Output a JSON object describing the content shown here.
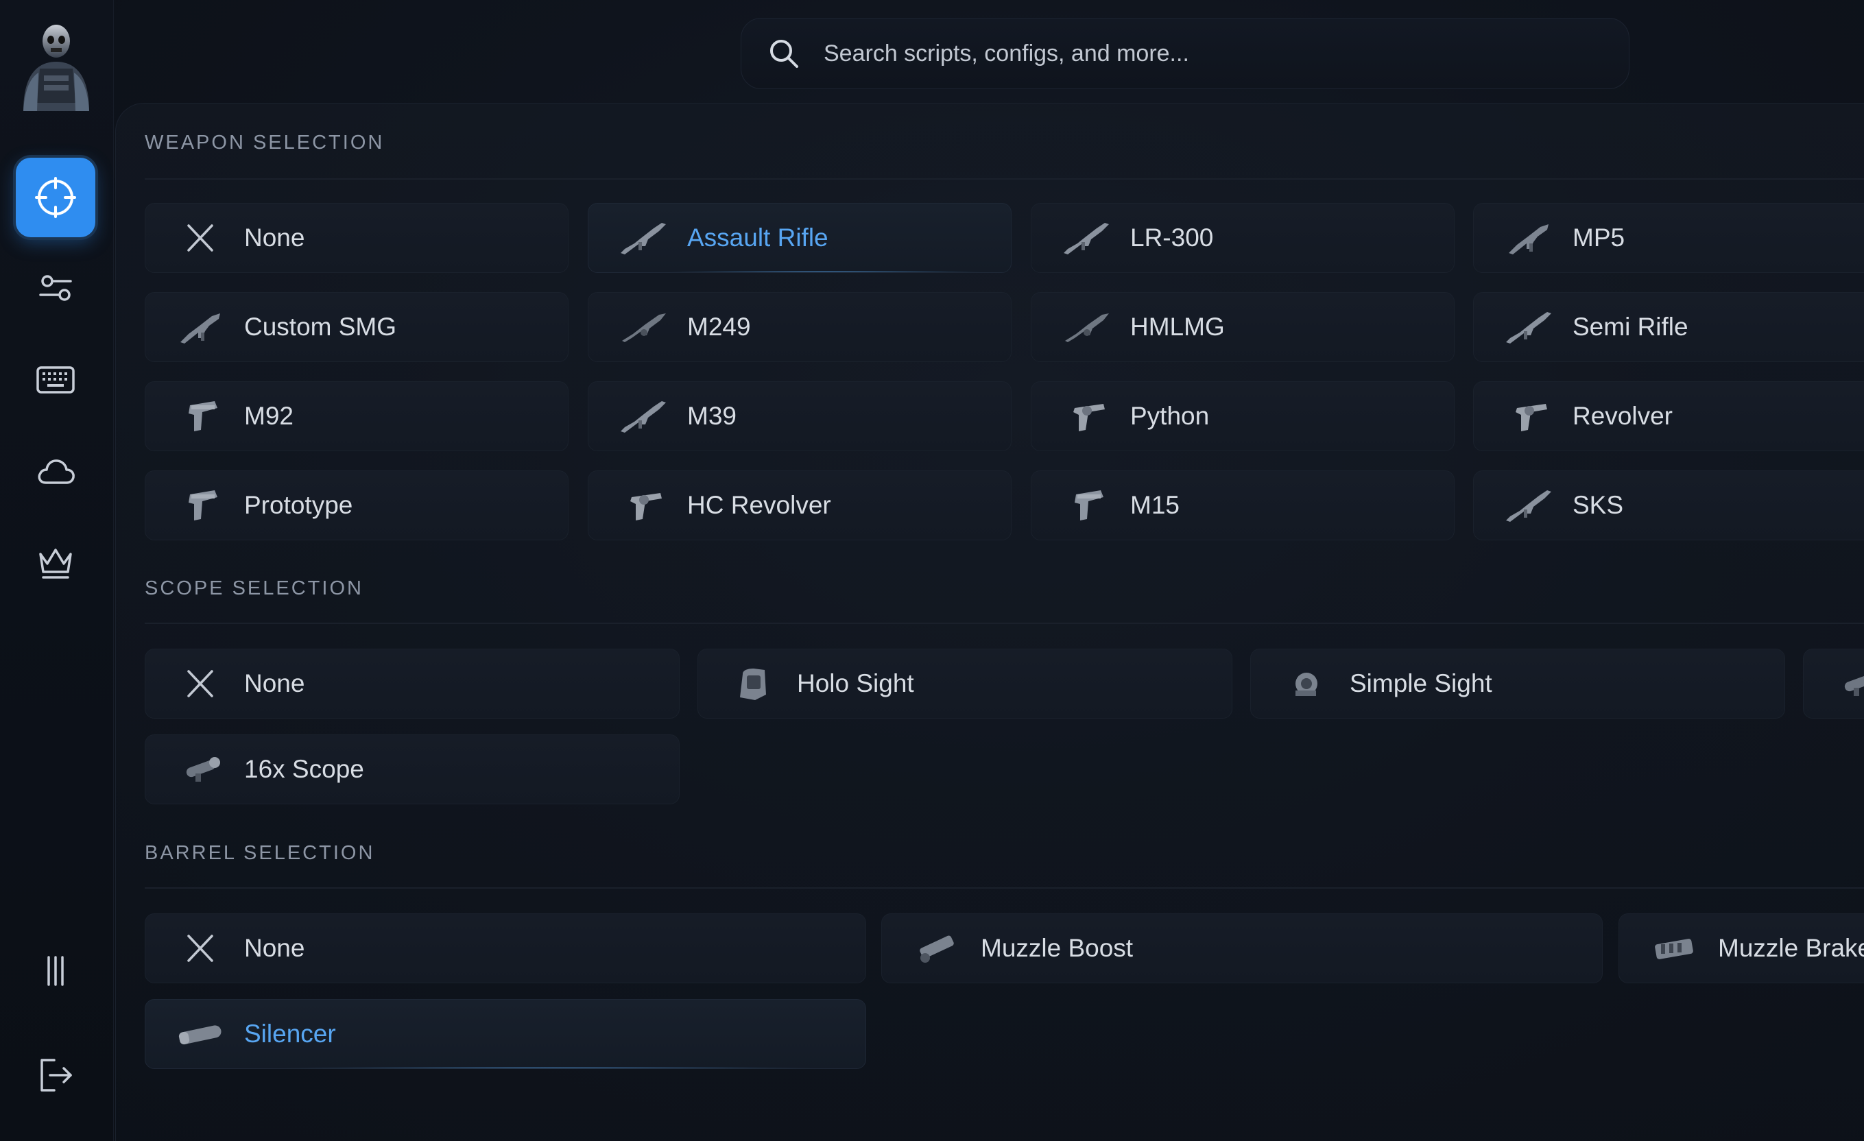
{
  "search": {
    "placeholder": "Search scripts, configs, and more..."
  },
  "sidebar": {
    "items": [
      {
        "name": "crosshair-icon",
        "active": true
      },
      {
        "name": "sliders-icon",
        "active": false
      },
      {
        "name": "keyboard-icon",
        "active": false
      },
      {
        "name": "cloud-icon",
        "active": false
      },
      {
        "name": "crown-icon",
        "active": false
      },
      {
        "name": "menu-bars-icon",
        "active": false
      },
      {
        "name": "logout-icon",
        "active": false
      }
    ]
  },
  "colors": {
    "accent": "#2f8df0",
    "selected_text": "#58a6f2",
    "background": "#0d1119",
    "card": "#161c27"
  },
  "weapon": {
    "title": "WEAPON SELECTION",
    "items": [
      {
        "label": "None",
        "icon": "close-icon"
      },
      {
        "label": "Assault Rifle",
        "icon": "rifle-icon",
        "selected": true
      },
      {
        "label": "LR-300",
        "icon": "rifle-icon"
      },
      {
        "label": "MP5",
        "icon": "smg-icon"
      },
      {
        "label": "Custom SMG",
        "icon": "smg-icon"
      },
      {
        "label": "M249",
        "icon": "lmg-icon"
      },
      {
        "label": "HMLMG",
        "icon": "lmg-icon"
      },
      {
        "label": "Semi Rifle",
        "icon": "rifle-icon"
      },
      {
        "label": "M92",
        "icon": "pistol-icon"
      },
      {
        "label": "M39",
        "icon": "rifle-icon"
      },
      {
        "label": "Python",
        "icon": "revolver-icon"
      },
      {
        "label": "Revolver",
        "icon": "revolver-icon"
      },
      {
        "label": "Prototype",
        "icon": "pistol-icon"
      },
      {
        "label": "HC Revolver",
        "icon": "revolver-icon"
      },
      {
        "label": "M15",
        "icon": "pistol-icon"
      },
      {
        "label": "SKS",
        "icon": "rifle-icon"
      }
    ]
  },
  "scope": {
    "title": "SCOPE SELECTION",
    "items": [
      {
        "label": "None",
        "icon": "close-icon"
      },
      {
        "label": "Holo Sight",
        "icon": "holo-sight-icon"
      },
      {
        "label": "Simple Sight",
        "icon": "simple-sight-icon"
      },
      {
        "label": "",
        "icon": "scope-icon"
      },
      {
        "label": "16x Scope",
        "icon": "scope-icon"
      }
    ]
  },
  "barrel": {
    "title": "BARREL SELECTION",
    "items": [
      {
        "label": "None",
        "icon": "close-icon"
      },
      {
        "label": "Muzzle Boost",
        "icon": "muzzle-boost-icon"
      },
      {
        "label": "Muzzle Brake",
        "icon": "muzzle-brake-icon"
      },
      {
        "label": "Silencer",
        "icon": "silencer-icon",
        "selected": true
      }
    ]
  }
}
